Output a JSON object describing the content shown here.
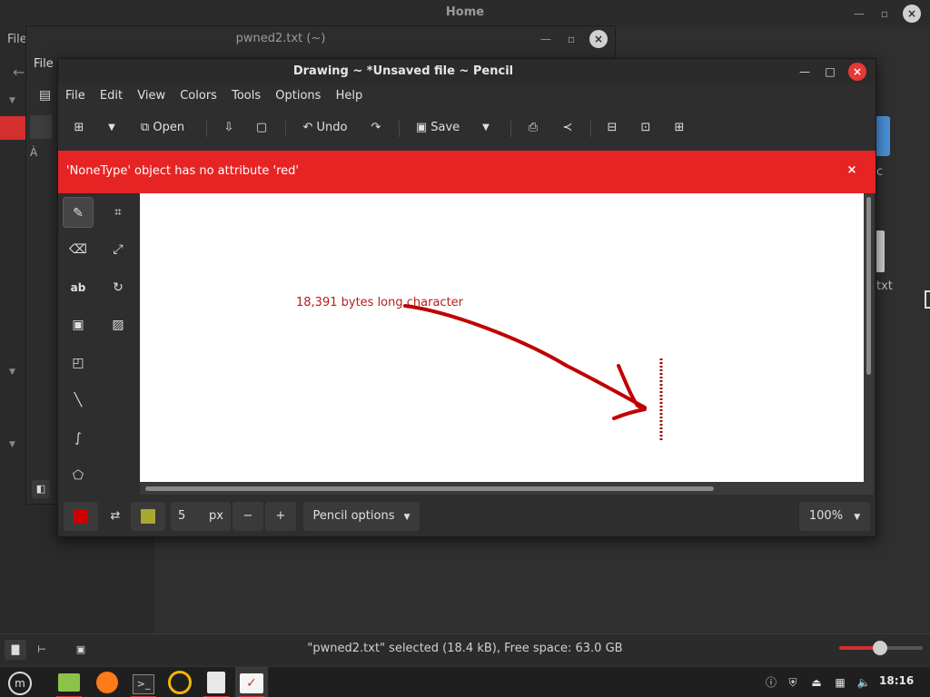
{
  "home_window": {
    "title": "Home",
    "left_labels": [
      "File",
      "File"
    ],
    "right_labels": [
      "c",
      "txt"
    ],
    "status_text": "\"pwned2.txt\" selected (18.4 kB), Free space: 63.0 GB"
  },
  "editor_window": {
    "title": "pwned2.txt (~)"
  },
  "drawing": {
    "title": "Drawing ~ *Unsaved file ~ Pencil",
    "menu": [
      "File",
      "Edit",
      "View",
      "Colors",
      "Tools",
      "Options",
      "Help"
    ],
    "toolbar": {
      "open_label": "Open",
      "undo_label": "Undo",
      "save_label": "Save"
    },
    "error_message": "'NoneType' object has no attribute 'red'",
    "canvas_text": "18,391 bytes long character",
    "bottom": {
      "size_value": "5",
      "size_unit": "px",
      "options_label": "Pencil options",
      "zoom_label": "100%"
    },
    "colors": {
      "primary": "#cc0000",
      "secondary": "#a8a832",
      "stroke": "#c00000",
      "error_bar": "#e62424"
    }
  },
  "taskbar": {
    "clock": "18:16"
  }
}
